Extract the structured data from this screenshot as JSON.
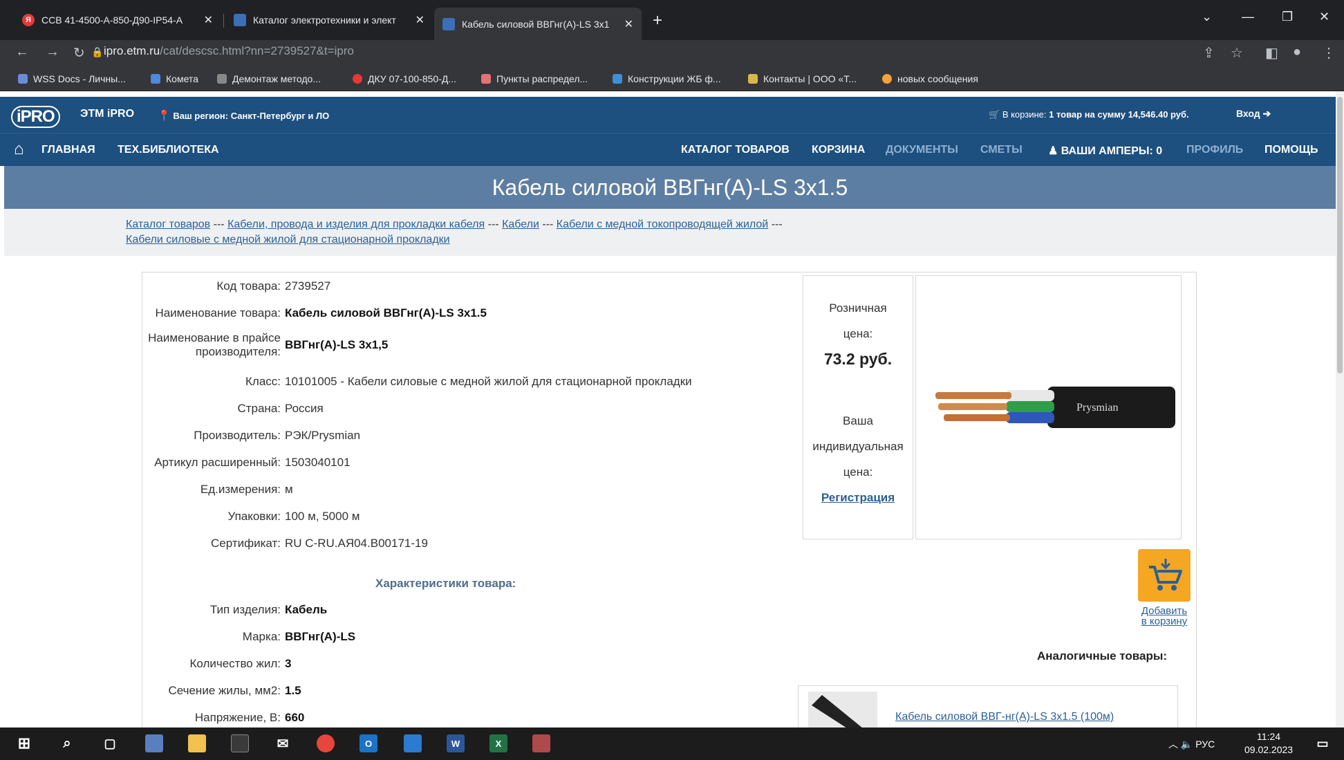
{
  "browser": {
    "tabs": [
      {
        "label": "ССВ 41-4500-А-850-Д90-IP54-А",
        "favicon_color": "#e53935",
        "favicon_text": "Я"
      },
      {
        "label": "Каталог электротехники и элект",
        "favicon_color": "#3d6fb6",
        "favicon_text": ""
      },
      {
        "label": "Кабель силовой ВВГнг(А)-LS 3х1",
        "favicon_color": "#3d6fb6",
        "favicon_text": ""
      }
    ],
    "url_domain": "ipro.etm.ru",
    "url_path": "/cat/descsc.html?nn=2739527&t=ipro",
    "bookmarks": [
      {
        "label": "WSS Docs - Личны...",
        "color": "#6a8cd8"
      },
      {
        "label": "Комета",
        "color": "#4f87e0"
      },
      {
        "label": "Демонтаж методо...",
        "color": "#888888"
      },
      {
        "label": "ДКУ 07-100-850-Д...",
        "color": "#e53935"
      },
      {
        "label": "Пункты распредел...",
        "color": "#e57373"
      },
      {
        "label": "Конструкции ЖБ ф...",
        "color": "#3d8fd8"
      },
      {
        "label": "Контакты | ООО «Т...",
        "color": "#d8b84a"
      },
      {
        "label": "новых сообщения",
        "color": "#f2a33a"
      }
    ]
  },
  "site": {
    "logo": "iPRO",
    "name": "ЭТМ iPRO",
    "region": "Ваш регион: Санкт-Петербург и ЛО",
    "cart_prefix": "В корзине:",
    "cart_summary": "1 товар на сумму 14,546.40 руб.",
    "login": "Вход",
    "nav_left": [
      "ГЛАВНАЯ",
      "ТЕХ.БИБЛИОТЕКА"
    ],
    "nav_right": [
      {
        "label": "КАТАЛОГ ТОВАРОВ",
        "dim": false
      },
      {
        "label": "КОРЗИНА",
        "dim": false
      },
      {
        "label": "ДОКУМЕНТЫ",
        "dim": true
      },
      {
        "label": "СМЕТЫ",
        "dim": true
      },
      {
        "label": "ВАШИ АМПЕРЫ: 0",
        "dim": false
      },
      {
        "label": "ПРОФИЛЬ",
        "dim": true
      },
      {
        "label": "ПОМОЩЬ",
        "dim": false
      }
    ]
  },
  "page": {
    "title": "Кабель силовой ВВГнг(А)-LS 3х1.5",
    "breadcrumbs": [
      "Каталог товаров",
      "Кабели, провода и изделия для прокладки кабеля",
      "Кабели",
      "Кабели с медной токопроводящей жилой",
      "Кабели силовые с медной жилой для стационарной прокладки"
    ],
    "breadcrumb_sep": "---"
  },
  "product": {
    "fields": [
      {
        "label": "Код товара:",
        "value": "2739527",
        "bold": false
      },
      {
        "label": "Наименование товара:",
        "value": "Кабель силовой ВВГнг(А)-LS 3х1.5",
        "bold": true
      },
      {
        "label": "Наименование в прайсе производителя:",
        "value": "ВВГнг(А)-LS 3х1,5",
        "bold": true
      },
      {
        "label": "Класс:",
        "value": "10101005 - Кабели силовые с медной жилой для стационарной прокладки",
        "bold": false
      },
      {
        "label": "Страна:",
        "value": "Россия",
        "bold": false
      },
      {
        "label": "Производитель:",
        "value": "РЭК/Prysmian",
        "bold": false
      },
      {
        "label": "Артикул расширенный:",
        "value": "1503040101",
        "bold": false
      },
      {
        "label": "Ед.измерения:",
        "value": "м",
        "bold": false
      },
      {
        "label": "Упаковки:",
        "value": "100 м, 5000 м",
        "bold": false
      },
      {
        "label": "Сертификат:",
        "value": "RU C-RU.АЯ04.В00171-19",
        "bold": false
      }
    ],
    "characteristics_title": "Характеристики товара:",
    "characteristics": [
      {
        "label": "Тип изделия:",
        "value": "Кабель"
      },
      {
        "label": "Марка:",
        "value": "ВВГнг(А)-LS"
      },
      {
        "label": "Количество жил:",
        "value": "3"
      },
      {
        "label": "Сечение жилы, мм2:",
        "value": "1.5"
      },
      {
        "label": "Напряжение, В:",
        "value": "660"
      }
    ],
    "retail_label_1": "Розничная",
    "retail_label_2": "цена:",
    "retail_price": "73.2 руб.",
    "indiv_label_1": "Ваша",
    "indiv_label_2": "индивидуальная",
    "indiv_label_3": "цена:",
    "register_link": "Регистрация",
    "image_brand": "Prysmian",
    "add_to_cart_1": "Добавить",
    "add_to_cart_2": "в корзину",
    "analog_title": "Аналогичные товары:",
    "analog_item": "Кабель силовой ВВГ-нг(А)-LS 3х1.5 (100м)"
  },
  "taskbar": {
    "lang": "РУС",
    "time": "11:24",
    "date": "09.02.2023"
  }
}
